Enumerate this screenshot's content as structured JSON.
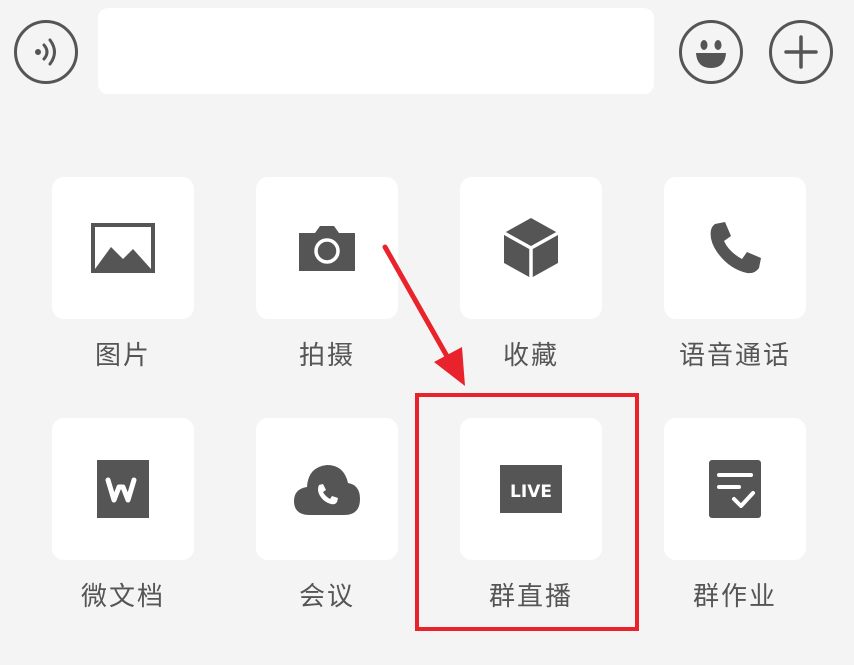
{
  "input_bar": {
    "text_value": "",
    "voice_icon": "voice-input-icon",
    "emoji_icon": "emoji-icon",
    "plus_icon": "plus-icon"
  },
  "panel": {
    "items": [
      {
        "label": "图片",
        "icon": "image-icon"
      },
      {
        "label": "拍摄",
        "icon": "camera-icon"
      },
      {
        "label": "收藏",
        "icon": "favorites-box-icon"
      },
      {
        "label": "语音通话",
        "icon": "phone-icon"
      },
      {
        "label": "微文档",
        "icon": "w-document-icon"
      },
      {
        "label": "会议",
        "icon": "cloud-phone-icon"
      },
      {
        "label": "群直播",
        "icon": "live-icon",
        "icon_text": "LIVE"
      },
      {
        "label": "群作业",
        "icon": "homework-icon"
      }
    ]
  },
  "annotation": {
    "highlight_color": "#e8232b",
    "highlighted_item": "群直播"
  },
  "colors": {
    "background": "#f4f4f4",
    "tile": "#ffffff",
    "icon": "#555555",
    "accent": "#e8232b"
  }
}
